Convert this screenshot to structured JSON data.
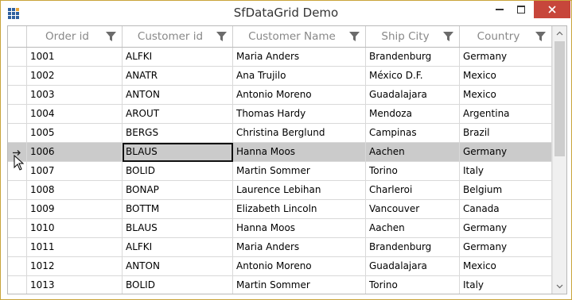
{
  "window": {
    "title": "SfDataGrid Demo"
  },
  "icons": {
    "app": "grid-app-icon",
    "minimize": "minimize-icon",
    "maximize": "maximize-icon",
    "close": "close-icon",
    "filter": "filter-funnel-icon",
    "current_row": "arrow-right-icon",
    "cursor": "mouse-pointer-icon"
  },
  "colors": {
    "close_button": "#c7463b",
    "selected_row": "#cbcbcb",
    "header_text": "#888888",
    "border": "#b9b9b9",
    "accent_icon": "#e8a53a"
  },
  "grid": {
    "columns": [
      "Order  id",
      "Customer id",
      "Customer Name",
      "Ship City",
      "Country"
    ],
    "selected_row_index": 5,
    "rows": [
      [
        "1001",
        "ALFKI",
        "Maria Anders",
        "Brandenburg",
        "Germany"
      ],
      [
        "1002",
        "ANATR",
        "Ana Trujilo",
        "México D.F.",
        "Mexico"
      ],
      [
        "1003",
        "ANTON",
        "Antonio Moreno",
        "Guadalajara",
        "Mexico"
      ],
      [
        "1004",
        "AROUT",
        "Thomas Hardy",
        "Mendoza",
        "Argentina"
      ],
      [
        "1005",
        "BERGS",
        "Christina Berglund",
        "Campinas",
        "Brazil"
      ],
      [
        "1006",
        "BLAUS",
        "Hanna Moos",
        "Aachen",
        "Germany"
      ],
      [
        "1007",
        "BOLID",
        "Martin Sommer",
        "Torino",
        "Italy"
      ],
      [
        "1008",
        "BONAP",
        "Laurence Lebihan",
        "Charleroi",
        "Belgium"
      ],
      [
        "1009",
        "BOTTM",
        "Elizabeth Lincoln",
        "Vancouver",
        "Canada"
      ],
      [
        "1010",
        "BLAUS",
        "Hanna Moos",
        "Aachen",
        "Germany"
      ],
      [
        "1011",
        "ALFKI",
        "Maria Anders",
        "Brandenburg",
        "Germany"
      ],
      [
        "1012",
        "ANTON",
        "Antonio Moreno",
        "Guadalajara",
        "Mexico"
      ],
      [
        "1013",
        "BOLID",
        "Martin Sommer",
        "Torino",
        "Italy"
      ]
    ]
  }
}
